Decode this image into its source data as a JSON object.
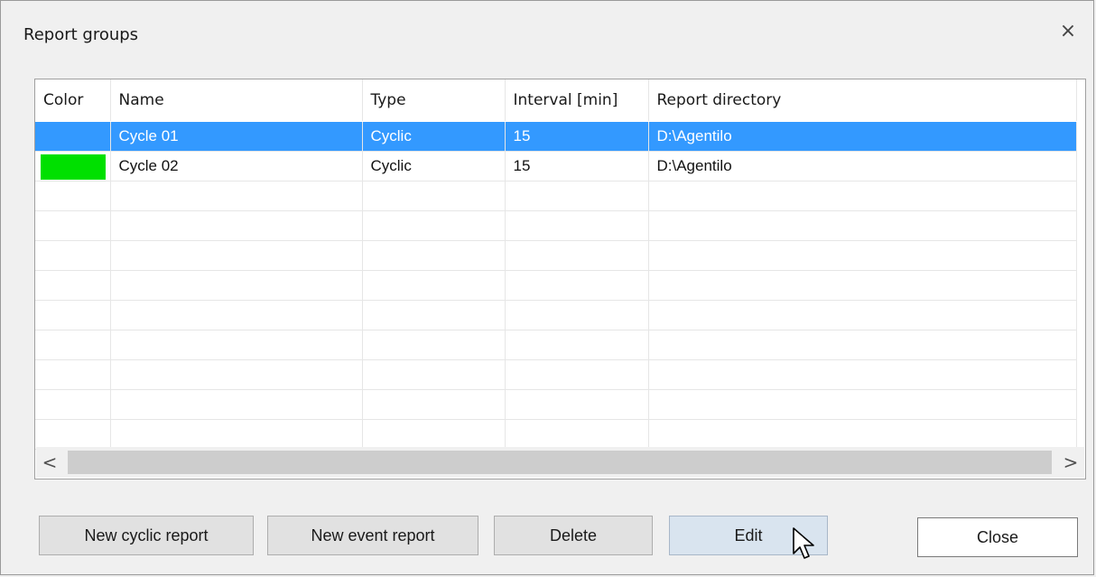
{
  "window": {
    "title": "Report groups",
    "close_glyph": "×"
  },
  "table": {
    "columns": [
      "Color",
      "Name",
      "Type",
      "Interval [min]",
      "Report directory"
    ],
    "rows": [
      {
        "color": "#3399ff",
        "name": "Cycle 01",
        "type": "Cyclic",
        "interval": "15",
        "directory": "D:\\Agentilo",
        "selected": true
      },
      {
        "color": "#00e000",
        "name": "Cycle 02",
        "type": "Cyclic",
        "interval": "15",
        "directory": "D:\\Agentilo",
        "selected": false
      }
    ],
    "empty_rows": 9
  },
  "scrollbar": {
    "left_arrow": "<",
    "right_arrow": ">"
  },
  "buttons": {
    "new_cyclic": "New cyclic report",
    "new_event": "New event report",
    "delete": "Delete",
    "edit": "Edit",
    "close": "Close"
  },
  "colors": {
    "selection": "#3399ff",
    "row_green": "#00e000",
    "hover_button": "#d9e4ef"
  }
}
